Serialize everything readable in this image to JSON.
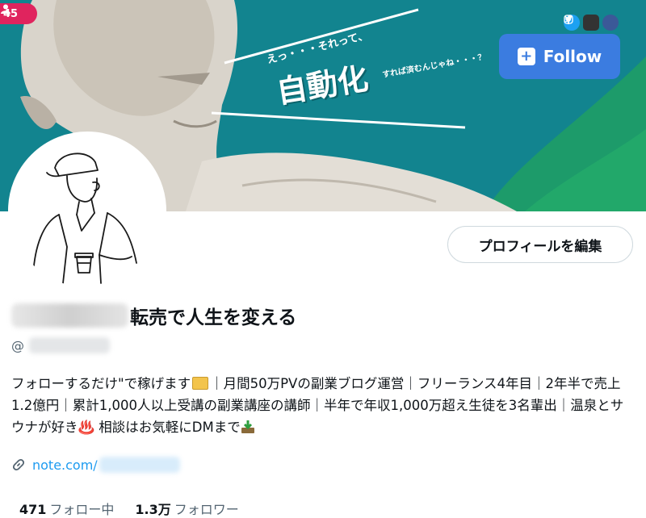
{
  "banner": {
    "follower_badge_count": "45",
    "catch_top": "えっ・・・それって、",
    "catch_main": "自動化",
    "catch_sub": "すれば済むんじゃね・・・？",
    "follow_button_label": "Follow",
    "social_icons": [
      "twitter-icon",
      "instagram-icon",
      "facebook-icon"
    ],
    "colors": {
      "teal": "#12848f",
      "follow_blue": "#3b7ce0",
      "badge_red": "#e0245e"
    }
  },
  "profile": {
    "edit_button_label": "プロフィールを編集",
    "display_name_visible": "転売で人生を変える",
    "handle_prefix": "@",
    "bio_part1": "フォローするだけ\"で稼げます",
    "bio_part2": "｜月間50万PVの副業ブログ運営｜フリーランス4年目｜2年半で売上1.2億円｜累計1,000人以上受講の副業講座の講師｜半年で年収1,000万超え生徒を3名輩出｜温泉とサウナが好き♨️ 相談はお気軽にDMまで",
    "link_text": "note.com/",
    "following_count": "471",
    "following_label": "フォロー中",
    "followers_count": "1.3万",
    "followers_label": "フォロワー",
    "link_color": "#1d9bf0"
  }
}
